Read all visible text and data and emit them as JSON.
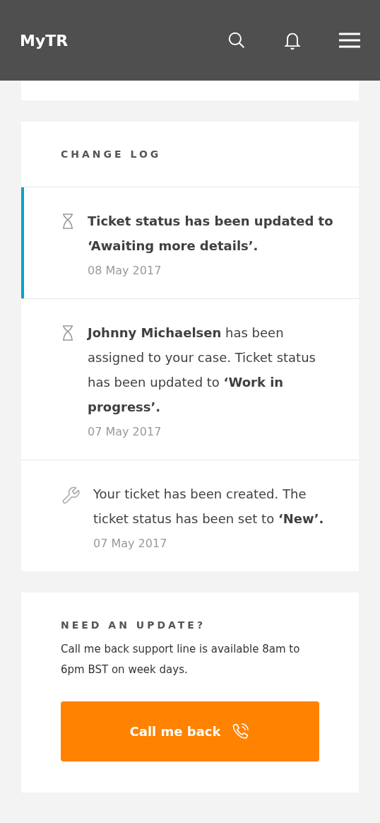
{
  "header": {
    "logo": "MyTR"
  },
  "change_log": {
    "title": "CHANGE LOG",
    "entries": [
      {
        "kind": "hourglass",
        "selected": true,
        "text": "Ticket status has been updated to ‘Awaiting more details’.",
        "date": "08 May 2017"
      },
      {
        "kind": "hourglass",
        "selected": false,
        "text": "**Johnny Michaelsen** has been assigned to your case. Ticket status has been updated to **‘Work in progress’.**",
        "date": "07 May 2017"
      },
      {
        "kind": "wrench",
        "selected": false,
        "text": "Your ticket has been created. The ticket status has been set to **‘New’.**",
        "date": "07 May 2017"
      }
    ]
  },
  "update": {
    "title": "NEED AN UPDATE?",
    "text": "Call me back support line is available 8am to 6pm BST on week days.",
    "button": "Call me back"
  }
}
